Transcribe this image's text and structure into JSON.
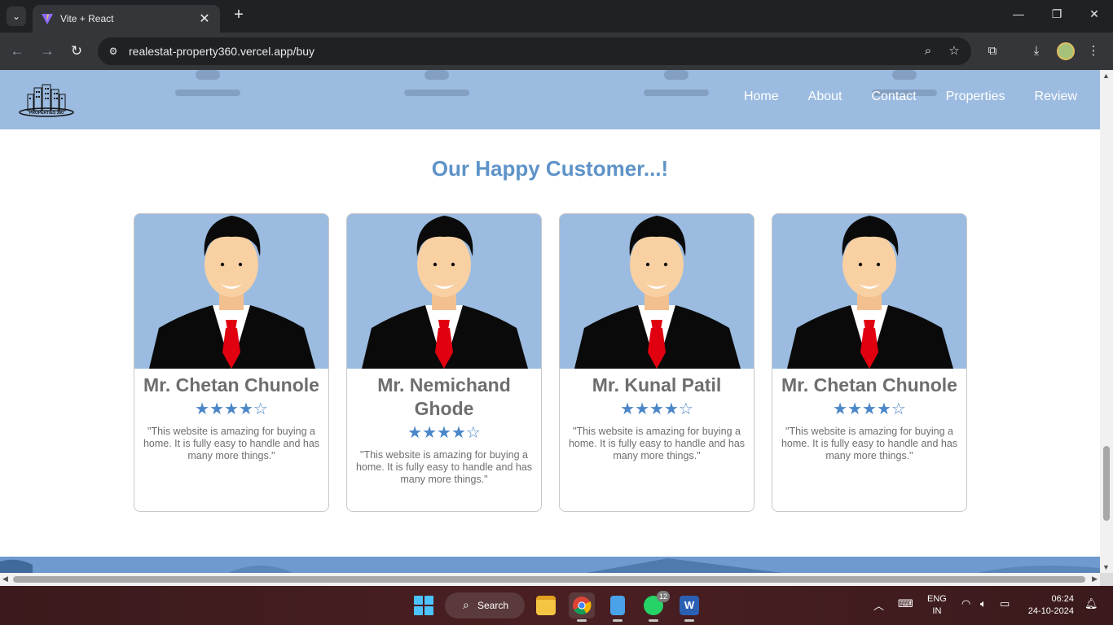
{
  "browser": {
    "tab_title": "Vite + React",
    "url": "realestat-property360.vercel.app/buy"
  },
  "site": {
    "logo_text": "PROPERTIES 360",
    "nav": [
      "Home",
      "About",
      "Contact",
      "Properties",
      "Review"
    ],
    "section_title": "Our Happy Customer...!",
    "cards": [
      {
        "name": "Mr. Chetan Chunole",
        "stars": "★★★★☆",
        "rating": 4,
        "quote": "\"This website is amazing for buying a home. It is fully easy to handle and has many more things.\""
      },
      {
        "name": "Mr. Nemichand Ghode",
        "stars": "★★★★☆",
        "rating": 4,
        "quote": "\"This website is amazing for buying a home. It is fully easy to handle and has many more things.\""
      },
      {
        "name": "Mr. Kunal Patil",
        "stars": "★★★★☆",
        "rating": 4,
        "quote": "\"This website is amazing for buying a home. It is fully easy to handle and has many more things.\""
      },
      {
        "name": "Mr. Chetan Chunole",
        "stars": "★★★★☆",
        "rating": 4,
        "quote": "\"This website is amazing for buying a home. It is fully easy to handle and has many more things.\""
      }
    ]
  },
  "taskbar": {
    "search_label": "Search",
    "whatsapp_badge": "12",
    "lang_line1": "ENG",
    "lang_line2": "IN",
    "time": "06:24",
    "date": "24-10-2024"
  },
  "colors": {
    "header_bg": "#9bbbe0",
    "accent": "#5e93c8",
    "star": "#4a86c8"
  }
}
